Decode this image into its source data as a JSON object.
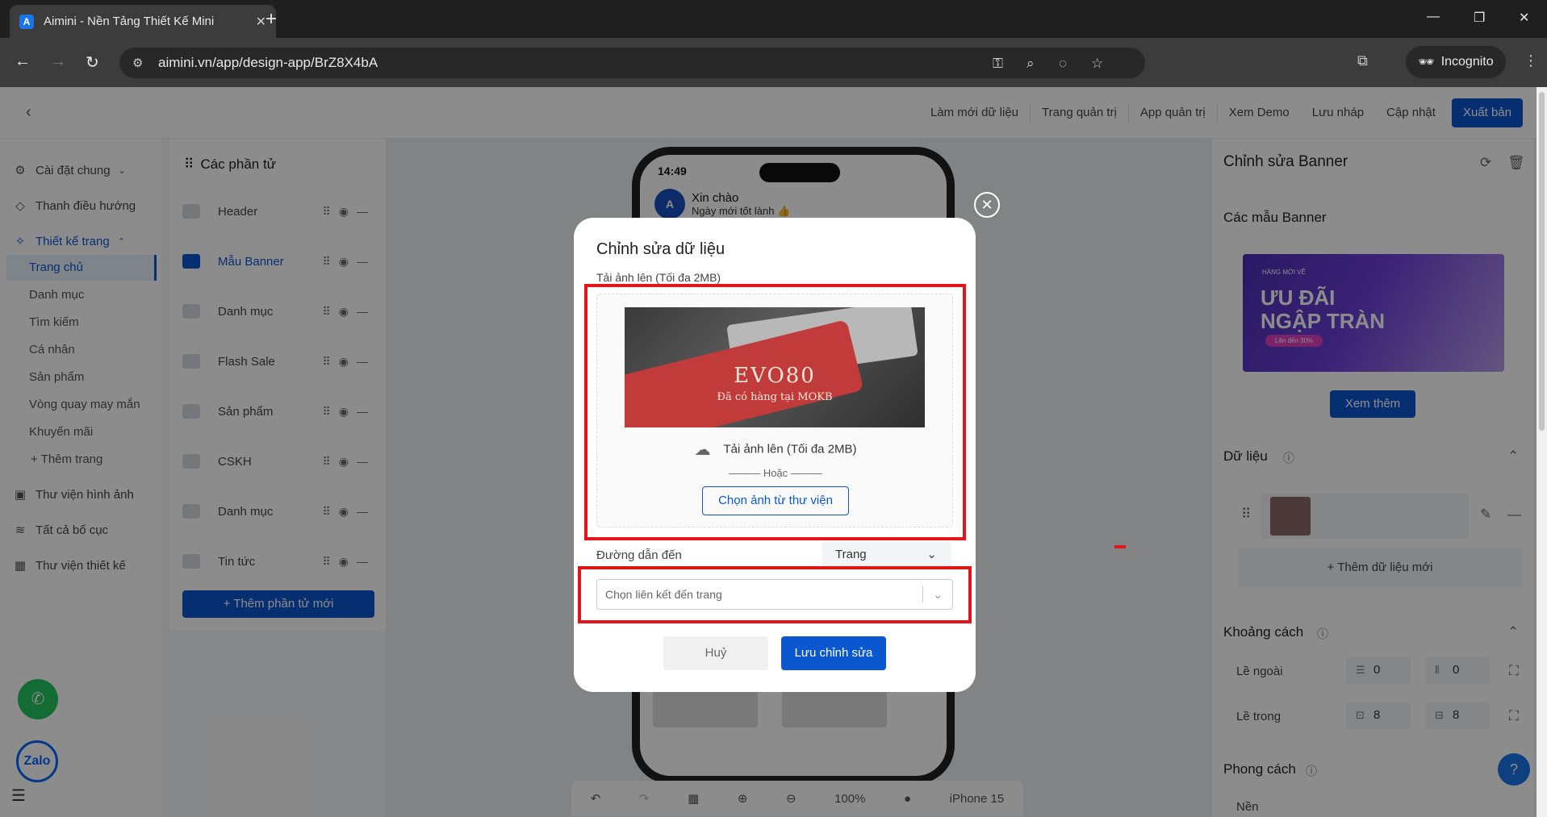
{
  "browser": {
    "tab_title": "Aimini - Nền Tảng Thiết Kế Mini",
    "url": "aimini.vn/app/design-app/BrZ8X4bA",
    "incognito_label": "Incognito"
  },
  "topnav": {
    "refresh_data": "Làm mới dữ liệu",
    "admin_page": "Trang quản trị",
    "admin_app": "App quản trị",
    "demo": "Xem Demo",
    "draft": "Lưu nháp",
    "update": "Cập nhật",
    "publish": "Xuất bản"
  },
  "leftnav": {
    "general": "Cài đặt chung",
    "navbar": "Thanh điều hướng",
    "page_design": "Thiết kế trang",
    "pages": [
      "Trang chủ",
      "Danh mục",
      "Tìm kiếm",
      "Cá nhân",
      "Sản phẩm",
      "Vòng quay may mắn",
      "Khuyến mãi"
    ],
    "add_page": "+ Thêm trang",
    "image_library": "Thư viện hình ảnh",
    "all_layouts": "Tất cả bố cục",
    "design_library": "Thư viện thiết kế"
  },
  "elements": {
    "title": "Các phần tử",
    "items": [
      "Header",
      "Mẫu Banner",
      "Danh mục",
      "Flash Sale",
      "Sản phẩm",
      "CSKH",
      "Danh mục",
      "Tin tức"
    ],
    "add_button": "+ Thêm phần tử mới"
  },
  "phone": {
    "time": "14:49",
    "greeting": "Xin chào",
    "wish": "Ngày mới tốt lành 👍"
  },
  "toolbar": {
    "zoom": "100%",
    "device": "iPhone 15"
  },
  "right": {
    "title": "Chỉnh sửa Banner",
    "templates": "Các mẫu Banner",
    "banner_small": "HÀNG MỚI VỀ",
    "banner_big1": "ƯU ĐÃI",
    "banner_big2": "NGẬP TRÀN",
    "banner_pill": "Lên đến 30%",
    "see_more": "Xem thêm",
    "data": "Dữ liệu",
    "add_data": "+ Thêm dữ liệu mới",
    "spacing": "Khoảng cách",
    "margin": "Lề ngoài",
    "padding": "Lề trong",
    "margin_v": "0",
    "margin_h": "0",
    "padding_v": "8",
    "padding_h": "8",
    "style": "Phong cách",
    "background": "Nền"
  },
  "modal": {
    "title": "Chỉnh sửa dữ liệu",
    "upload_label": "Tải ảnh lên (Tối đa 2MB)",
    "image_title": "EVO80",
    "image_subtitle": "Đã có hàng tại MOKB",
    "upload_text": "Tải ảnh lên (Tối đa 2MB)",
    "or": "——— Hoặc ———",
    "library_button": "Chọn ảnh từ thư viện",
    "link_label": "Đường dẫn đến",
    "page_type": "Trang",
    "link_placeholder": "Chọn liên kết đến trang",
    "cancel": "Huỷ",
    "save": "Lưu chỉnh sửa"
  },
  "fab": {
    "zalo": "Zalo"
  }
}
